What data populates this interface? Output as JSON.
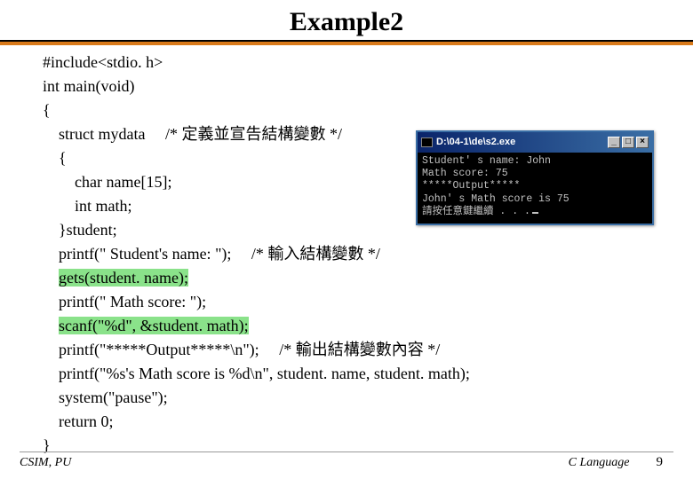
{
  "title": "Example2",
  "code": {
    "l1": "#include<stdio. h>",
    "l2": "int main(void)",
    "l3": "{",
    "l4a": "struct mydata     ",
    "l4b": "/* 定義並宣告結構變數 */",
    "l5": "{",
    "l6": "char name[15];",
    "l7": "int math;",
    "l8": "}student;",
    "l9a": "printf(\" Student's name: \");     ",
    "l9b": "/* 輸入結構變數 */",
    "l10": "gets(student. name);",
    "l11": "printf(\" Math score: \");",
    "l12": "scanf(\"%d\", &student. math);",
    "l13a": "printf(\"*****Output*****\\n\");     ",
    "l13b": "/* 輸出結構變數內容 */",
    "l14": "printf(\"%s's Math score is %d\\n\", student. name, student. math);",
    "l15": "system(\"pause\");",
    "l16": "return 0;",
    "l17": "}"
  },
  "terminal": {
    "title": "D:\\04-1\\de\\s2.exe",
    "btn_min": "_",
    "btn_max": "□",
    "btn_close": "×",
    "out1": "Student' s name: John",
    "out2": "Math score: 75",
    "out3": "*****Output*****",
    "out4": "John' s Math score is 75",
    "out5": "請按任意鍵繼續 . . ."
  },
  "footer": {
    "left": "CSIM, PU",
    "right": "C Language",
    "page": "9"
  }
}
